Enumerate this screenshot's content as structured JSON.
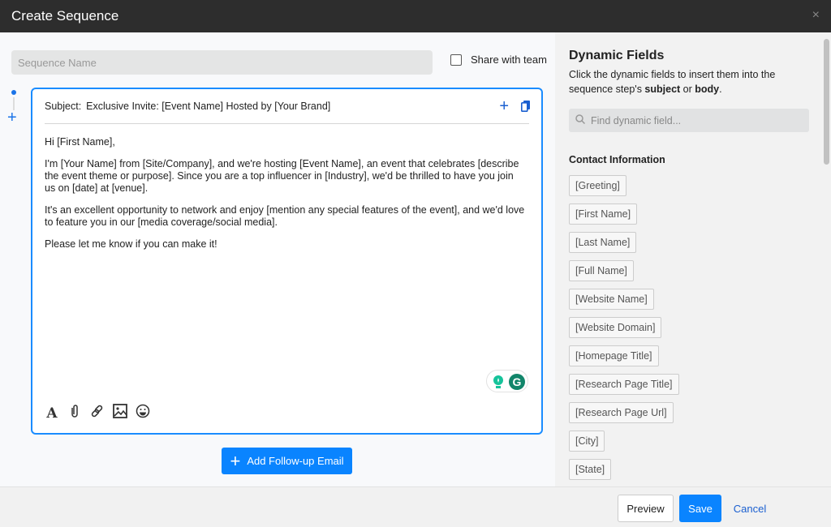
{
  "dialog": {
    "title": "Create Sequence",
    "close_icon": "×"
  },
  "sequence": {
    "name_placeholder": "Sequence Name",
    "share_label": "Share with team"
  },
  "editor": {
    "subject_label": "Subject:",
    "subject": "Exclusive Invite: [Event Name] Hosted by [Your Brand]",
    "body": [
      "Hi [First Name],",
      "I'm [Your Name] from [Site/Company], and we're hosting [Event Name], an event that celebrates [describe the event theme or purpose]. Since you are a top influencer in [Industry], we'd be thrilled to have you join us on [date] at [venue].",
      "It's an excellent opportunity to network and enjoy [mention any special features of the event], and we'd love to feature you in our [media coverage/social media].",
      "Please let me know if you can make it!"
    ],
    "tools": [
      "font-icon",
      "paperclip-icon",
      "link-icon",
      "image-icon",
      "emoji-icon"
    ]
  },
  "add_followup_label": "Add Follow-up Email",
  "dynamic": {
    "title": "Dynamic Fields",
    "desc_pre": "Click the dynamic fields to insert them into the sequence step's ",
    "desc_subject": "subject",
    "desc_or": " or ",
    "desc_body": "body",
    "desc_end": ".",
    "search_placeholder": "Find dynamic field...",
    "section": "Contact Information",
    "fields": [
      "[Greeting]",
      "[First Name]",
      "[Last Name]",
      "[Full Name]",
      "[Website Name]",
      "[Website Domain]",
      "[Homepage Title]",
      "[Research Page Title]",
      "[Research Page Url]",
      "[City]",
      "[State]"
    ]
  },
  "footer": {
    "preview": "Preview",
    "save": "Save",
    "cancel": "Cancel"
  },
  "colors": {
    "accent": "#0a84ff",
    "header": "#2d2d2d"
  }
}
